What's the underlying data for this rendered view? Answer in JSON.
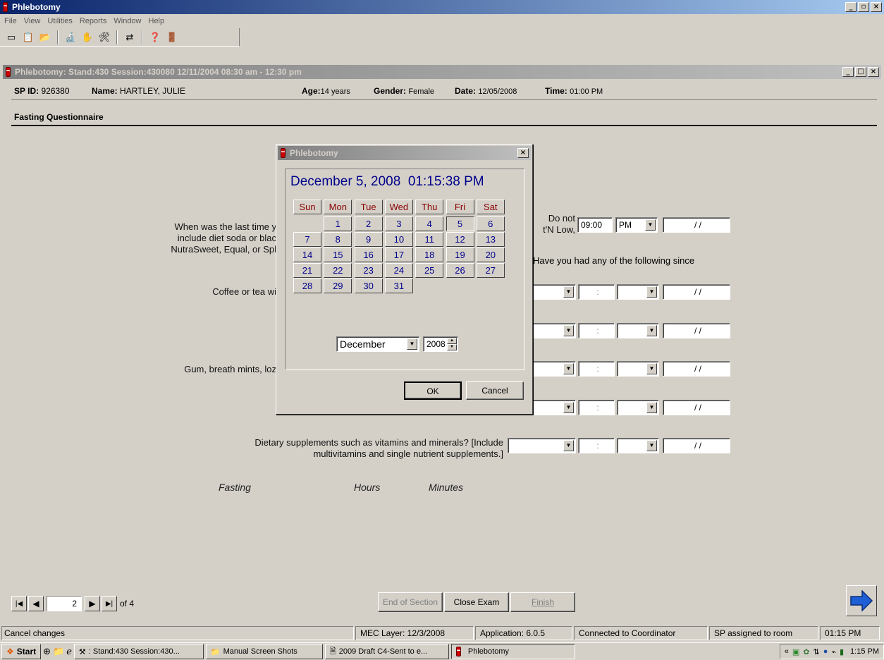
{
  "app": {
    "title": "Phlebotomy",
    "menu": [
      "File",
      "View",
      "Utilities",
      "Reports",
      "Window",
      "Help"
    ]
  },
  "child_window": {
    "title": "Phlebotomy: Stand:430 Session:430080 12/11/2004 08:30 am - 12:30 pm"
  },
  "patient": {
    "sp_id_label": "SP ID:",
    "sp_id": "926380",
    "name_label": "Name:",
    "name": "HARTLEY, JULIE",
    "age_label": "Age:",
    "age": "14 years",
    "gender_label": "Gender:",
    "gender": "Female",
    "date_label": "Date:",
    "date": "12/05/2008",
    "time_label": "Time:",
    "time": "01:00 PM"
  },
  "section_title": "Fasting Questionnaire",
  "questions": {
    "q1_line1": "When was the last time y",
    "q1_line2": "include diet soda or blac",
    "q1_line3": "NutraSweet, Equal, or Spl",
    "q1_right1": "Do not",
    "q1_right2": "t'N Low,",
    "q1_time": "09:00",
    "q1_ampm": "PM",
    "q1_date": "/ /",
    "q2_intro": "Have you had any of the following since",
    "coffee": "Coffee or tea wi",
    "gum": "Gum, breath mints, loz",
    "supp_line1": "Dietary supplements such as vitamins and minerals? [Include",
    "supp_line2": "multivitamins and single nutrient supplements.]",
    "colon": ":",
    "blank_date": "/ /"
  },
  "headers": {
    "fasting": "Fasting",
    "hours": "Hours",
    "minutes": "Minutes"
  },
  "dialog": {
    "title": "Phlebotomy",
    "datetime": "December 5, 2008  01:15:38 PM",
    "weekdays": [
      "Sun",
      "Mon",
      "Tue",
      "Wed",
      "Thu",
      "Fri",
      "Sat"
    ],
    "month": "December",
    "year": "2008",
    "ok": "OK",
    "cancel": "Cancel",
    "selected_day": "5"
  },
  "nav": {
    "page": "2",
    "of": "of 4",
    "end_of_section": "End of Section",
    "close_exam": "Close Exam",
    "finish": "Finish"
  },
  "status": {
    "left": "Cancel changes",
    "mec_layer": "MEC Layer: 12/3/2008",
    "application": "Application: 6.0.5",
    "connection": "Connected to Coordinator",
    "room": "SP assigned to room",
    "time": "01:15 PM"
  },
  "taskbar": {
    "start": "Start",
    "items": [
      ": Stand:430 Session:430...",
      "Manual Screen Shots",
      "2009 Draft C4-Sent to e...",
      "Phlebotomy"
    ],
    "tray_chevron": "«",
    "clock": "1:15 PM"
  }
}
